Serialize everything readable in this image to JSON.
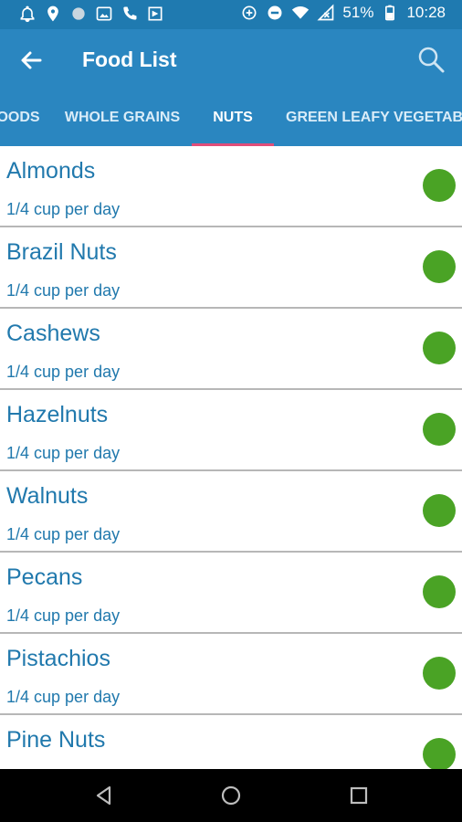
{
  "status_bar": {
    "battery_text": "51%",
    "time": "10:28"
  },
  "app_bar": {
    "title": "Food List"
  },
  "tabs": [
    {
      "label": "OODS",
      "active": false
    },
    {
      "label": "WHOLE GRAINS",
      "active": false
    },
    {
      "label": "NUTS",
      "active": true
    },
    {
      "label": "GREEN LEAFY VEGETABLES",
      "active": false
    }
  ],
  "items": [
    {
      "name": "Almonds",
      "serving": "1/4 cup per day"
    },
    {
      "name": "Brazil Nuts",
      "serving": "1/4 cup per day"
    },
    {
      "name": "Cashews",
      "serving": "1/4 cup per day"
    },
    {
      "name": "Hazelnuts",
      "serving": "1/4 cup per day"
    },
    {
      "name": "Walnuts",
      "serving": "1/4 cup per day"
    },
    {
      "name": "Pecans",
      "serving": "1/4 cup per day"
    },
    {
      "name": "Pistachios",
      "serving": "1/4 cup per day"
    },
    {
      "name": "Pine Nuts",
      "serving": ""
    }
  ],
  "colors": {
    "primary": "#2a86c0",
    "status_bar": "#1f7ab0",
    "accent": "#e04e7a",
    "text": "#2179ad",
    "indicator_dot": "#4aa325"
  }
}
